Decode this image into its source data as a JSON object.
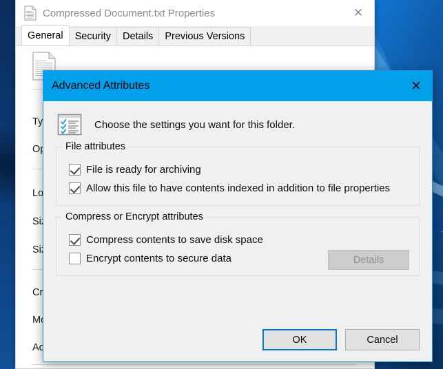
{
  "desktop": {
    "wallpaper_name": "windows-10-hero-wallpaper"
  },
  "properties_window": {
    "title": "Compressed Document.txt Properties",
    "title_icon": "text-document-icon",
    "close_label": "✕",
    "tabs": [
      {
        "label": "General",
        "active": true
      },
      {
        "label": "Security",
        "active": false
      },
      {
        "label": "Details",
        "active": false
      },
      {
        "label": "Previous Versions",
        "active": false
      }
    ],
    "fields": [
      {
        "label": "Typ"
      },
      {
        "label": "Op"
      },
      {
        "label": "Loc"
      },
      {
        "label": "Siz"
      },
      {
        "label": "Siz"
      },
      {
        "label": "Cre"
      },
      {
        "label": "Mo"
      },
      {
        "label": "Acc"
      }
    ]
  },
  "advanced_dialog": {
    "title": "Advanced Attributes",
    "close_label": "✕",
    "titlebar_color": "#00a0ea",
    "intro_icon": "checklist-icon",
    "intro_text": "Choose the settings you want for this folder.",
    "groups": [
      {
        "label": "File attributes",
        "checkboxes": [
          {
            "label": "File is ready for archiving",
            "checked": true
          },
          {
            "label": "Allow this file to have contents indexed in addition to file properties",
            "checked": true
          }
        ]
      },
      {
        "label": "Compress or Encrypt attributes",
        "checkboxes": [
          {
            "label": "Compress contents to save disk space",
            "checked": true
          },
          {
            "label": "Encrypt contents to secure data",
            "checked": false
          }
        ],
        "details_button": {
          "label": "Details",
          "enabled": false
        }
      }
    ],
    "buttons": [
      {
        "label": "OK",
        "default": true
      },
      {
        "label": "Cancel",
        "default": false
      }
    ]
  }
}
